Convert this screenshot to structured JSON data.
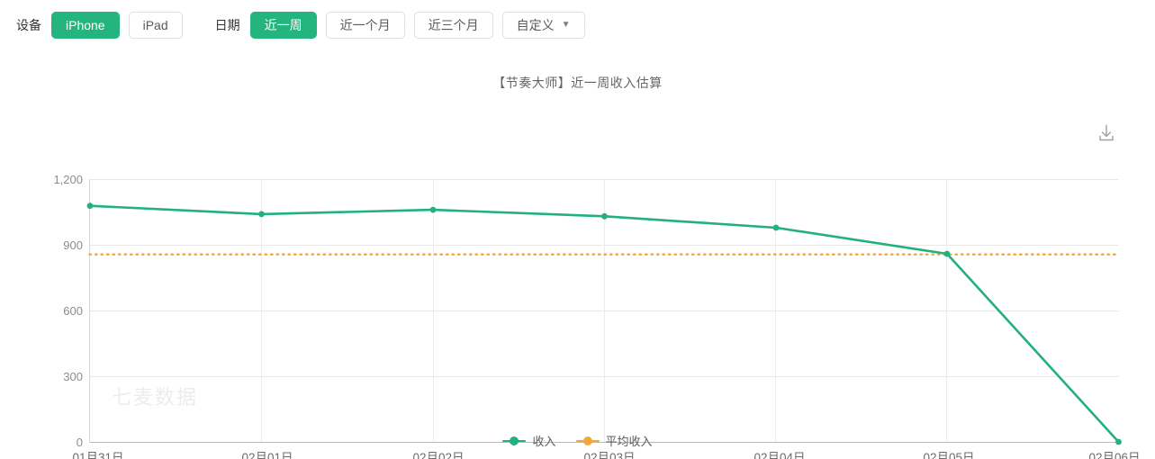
{
  "filters": {
    "device": {
      "label": "设备",
      "options": [
        {
          "label": "iPhone",
          "active": true
        },
        {
          "label": "iPad",
          "active": false
        }
      ]
    },
    "date": {
      "label": "日期",
      "options": [
        {
          "label": "近一周",
          "active": true
        },
        {
          "label": "近一个月",
          "active": false
        },
        {
          "label": "近三个月",
          "active": false
        },
        {
          "label": "自定义",
          "active": false,
          "caret": "▼"
        }
      ]
    }
  },
  "chart_panel": {
    "title": "【节奏大师】近一周收入估算",
    "download_icon": "download-icon",
    "watermark": "七麦数据"
  },
  "chart_data": {
    "type": "line",
    "title": "【节奏大师】近一周收入估算",
    "xlabel": "",
    "ylabel": "",
    "categories": [
      "01月31日",
      "02月01日",
      "02月02日",
      "02月03日",
      "02月04日",
      "02月05日",
      "02月06日"
    ],
    "ytick_labels": [
      "0",
      "300",
      "600",
      "900",
      "1,200"
    ],
    "ytick_values": [
      0,
      300,
      600,
      900,
      1200
    ],
    "ylim": [
      0,
      1200
    ],
    "grid": true,
    "legend_position": "bottom",
    "series": [
      {
        "name": "收入",
        "color": "#22b07d",
        "style": "solid",
        "markers": true,
        "values": [
          1078,
          1040,
          1060,
          1030,
          978,
          859,
          0
        ]
      },
      {
        "name": "平均收入",
        "color": "#f0a83c",
        "style": "dotted",
        "markers": false,
        "constant": 856,
        "values": [
          856,
          856,
          856,
          856,
          856,
          856,
          856
        ]
      }
    ]
  },
  "legend": [
    {
      "label": "收入",
      "color": "#22b07d"
    },
    {
      "label": "平均收入",
      "color": "#f0a83c"
    }
  ]
}
